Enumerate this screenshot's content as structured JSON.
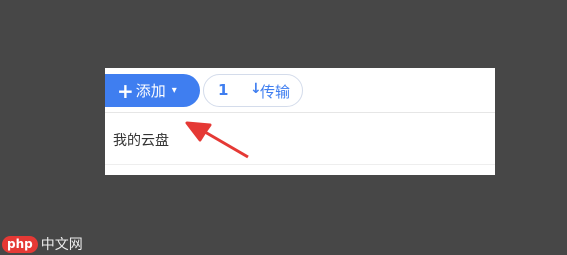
{
  "toolbar": {
    "add_label": "添加",
    "plus_glyph": "+",
    "caret_glyph": "▾",
    "transfer_count": "1",
    "transfer_icon": "download-arrow-icon",
    "transfer_label": "传输"
  },
  "breadcrumb": {
    "label": "我的云盘"
  },
  "watermark": {
    "badge": "php",
    "text": "中文网"
  },
  "colors": {
    "background": "#474747",
    "accent": "#3f7ef0",
    "annotation_arrow": "#e53935"
  }
}
